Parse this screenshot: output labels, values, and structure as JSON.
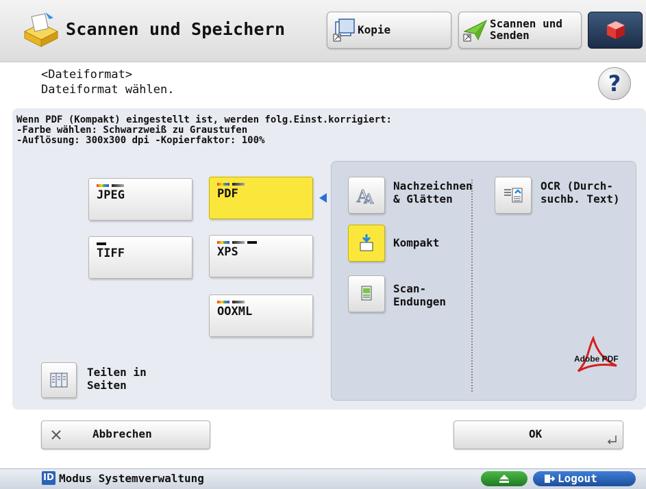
{
  "header": {
    "title": "Scannen und Speichern",
    "kopie_label": "Kopie",
    "senden_label_1": "Scannen und",
    "senden_label_2": "Senden"
  },
  "message": {
    "line1": "<Dateiformat>",
    "line2": "Dateiformat wählen.",
    "help": "?"
  },
  "info_text": "Wenn PDF (Kompakt) eingestellt ist, werden folg.Einst.korrigiert:\n-Farbe wählen: Schwarzweiß zu Graustufen\n-Auflösung: 300x300 dpi -Kopierfaktor: 100%",
  "formats": {
    "jpeg": "JPEG",
    "pdf": "PDF",
    "tiff": "TIFF",
    "xps": "XPS",
    "ooxml": "OOXML",
    "selected": "PDF"
  },
  "split": {
    "line1": "Teilen in",
    "line2": "Seiten"
  },
  "pdf_options": {
    "trace_1": "Nachzeichnen",
    "trace_2": "& Glätten",
    "compact": "Kompakt",
    "compact_selected": true,
    "scan_end_1": "Scan-",
    "scan_end_2": "Endungen",
    "ocr_1": "OCR (Durch-",
    "ocr_2": "suchb. Text)",
    "adobe_logo_text": "Adobe PDF"
  },
  "footer": {
    "cancel": "Abbrechen",
    "ok": "OK"
  },
  "status": {
    "id_label": "ID",
    "text": "Modus Systemverwaltung",
    "logout": "Logout"
  },
  "colors": {
    "selected_yellow": "#fbe73c",
    "accent_blue": "#2a6fd6",
    "panel_bg": "#e8ebf1"
  },
  "icons": [
    "scanner-box-icon",
    "copy-icon",
    "send-arrow-icon",
    "home-cube-icon",
    "help-icon",
    "split-pages-icon",
    "trace-smooth-icon",
    "compact-icon",
    "scan-endings-icon",
    "ocr-icon",
    "adobe-pdf-logo",
    "close-icon",
    "eject-icon",
    "logout-icon",
    "id-icon"
  ]
}
